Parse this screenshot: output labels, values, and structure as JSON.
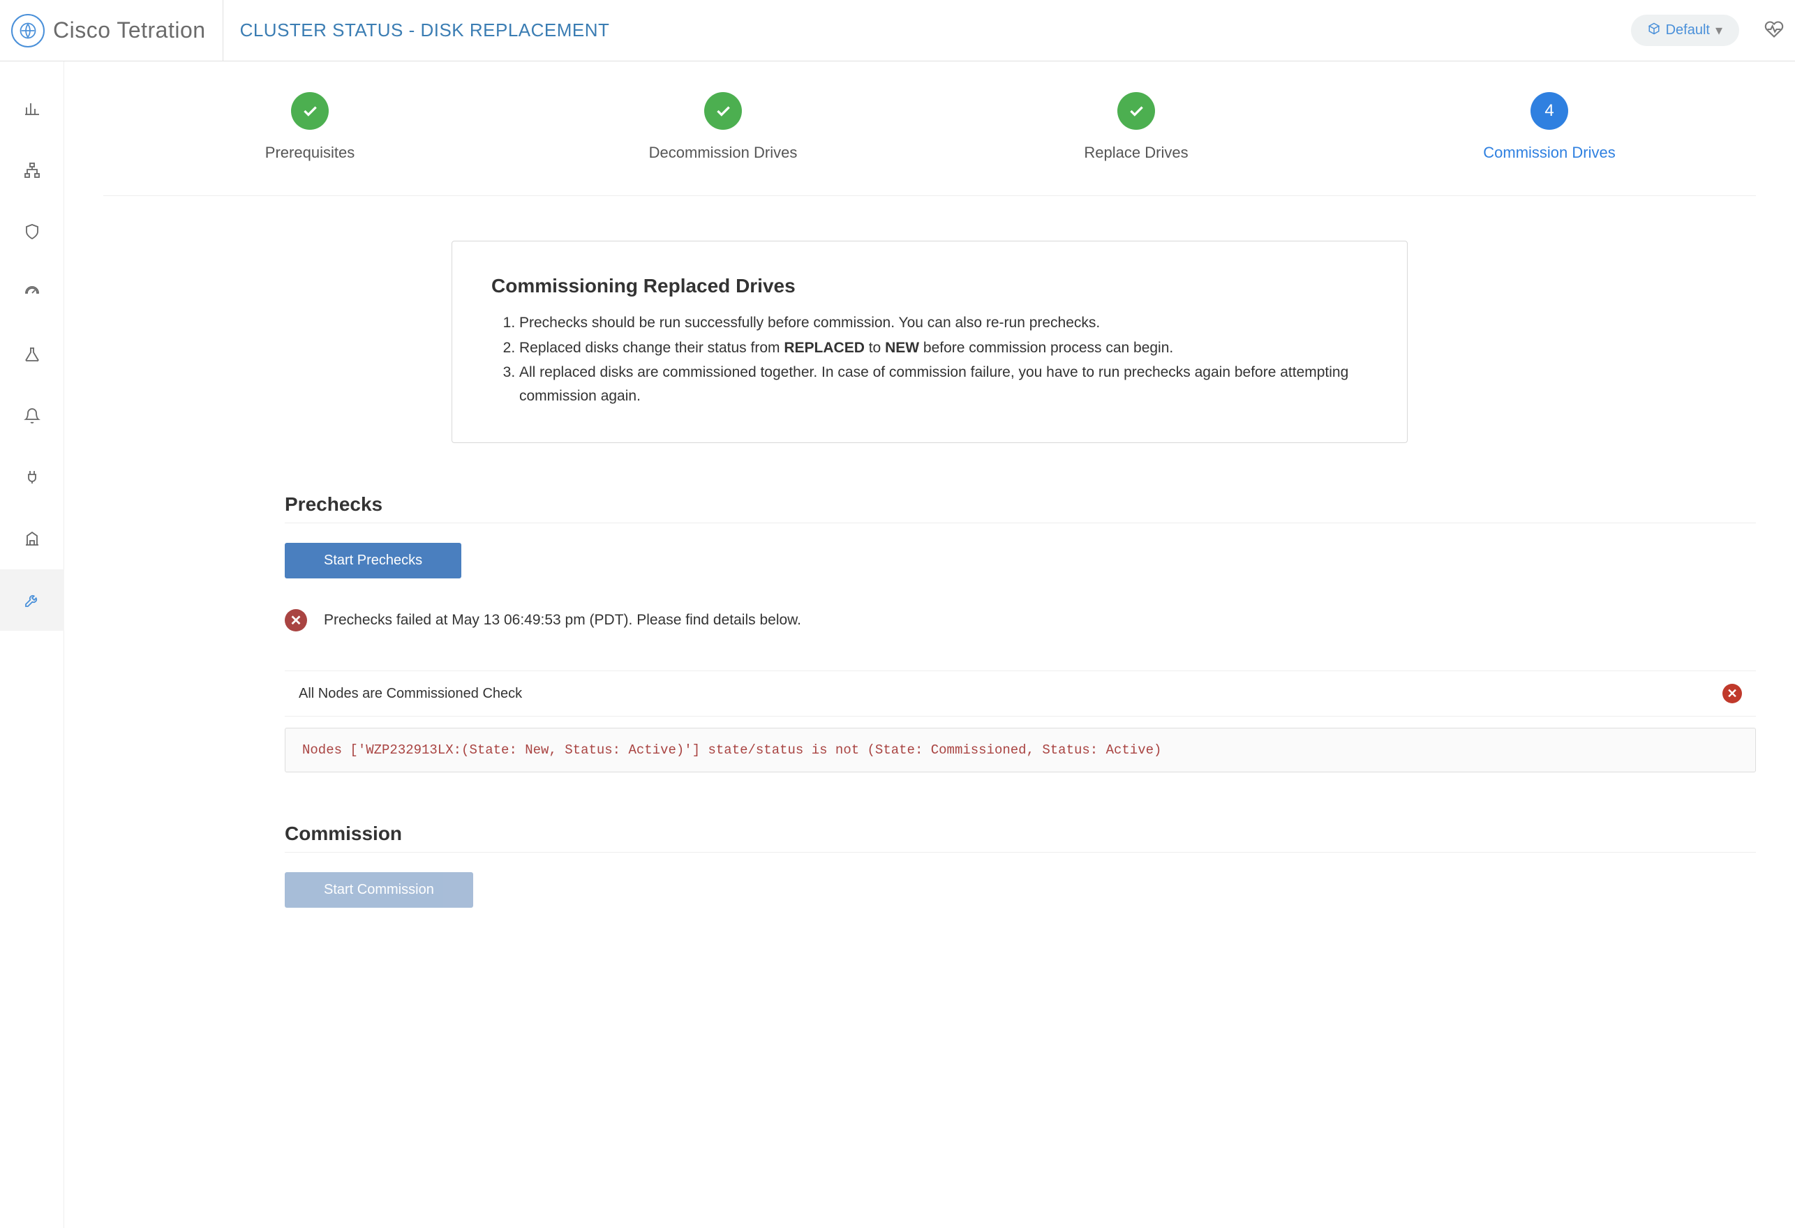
{
  "header": {
    "brand": "Cisco Tetration",
    "title": "CLUSTER STATUS - DISK REPLACEMENT",
    "tenant_label": "Default"
  },
  "wizard": {
    "steps": [
      {
        "label": "Prerequisites",
        "state": "complete"
      },
      {
        "label": "Decommission Drives",
        "state": "complete"
      },
      {
        "label": "Replace Drives",
        "state": "complete"
      },
      {
        "label": "Commission Drives",
        "state": "current",
        "number": "4"
      }
    ]
  },
  "info": {
    "heading": "Commissioning Replaced Drives",
    "items": {
      "0": "Prechecks should be run successfully before commission. You can also re-run prechecks.",
      "1a": "Replaced disks change their status from ",
      "1b": "REPLACED",
      "1c": " to ",
      "1d": "NEW",
      "1e": " before commission process can begin.",
      "2": "All replaced disks are commissioned together. In case of commission failure, you have to run prechecks again before attempting commission again."
    }
  },
  "prechecks": {
    "heading": "Prechecks",
    "button": "Start Prechecks",
    "failure_msg": "Prechecks failed at May 13 06:49:53 pm (PDT). Please find details below.",
    "check_label": "All Nodes are Commissioned Check",
    "error_detail": "Nodes ['WZP232913LX:(State: New, Status: Active)'] state/status is not (State: Commissioned, Status: Active)"
  },
  "commission": {
    "heading": "Commission",
    "button": "Start Commission"
  }
}
